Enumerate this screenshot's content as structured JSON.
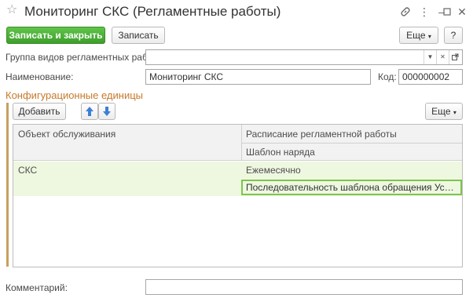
{
  "window": {
    "title": "Мониторинг СКС (Регламентные работы)",
    "icons": [
      "star-icon",
      "link-icon",
      "more-vertical-icon",
      "minimize-icon",
      "maximize-icon",
      "close-icon"
    ]
  },
  "toolbar": {
    "save_close_label": "Записать и закрыть",
    "save_label": "Записать",
    "more_label": "Еще",
    "help_label": "?"
  },
  "form": {
    "group_label": "Группа видов регламентных работ:",
    "group_value": "",
    "name_label": "Наименование:",
    "name_value": "Мониторинг СКС",
    "code_label": "Код:",
    "code_value": "000000002",
    "comment_label": "Комментарий:",
    "comment_value": ""
  },
  "config_units": {
    "section_title": "Конфигурационные единицы",
    "add_label": "Добавить",
    "more_label": "Еще",
    "columns": {
      "object": "Объект обслуживания",
      "schedule": "Расписание регламентной работы",
      "template": "Шаблон наряда"
    },
    "rows": [
      {
        "object": "СКС",
        "schedule": "Ежемесячно",
        "template": "Последовательность шаблона обращения Установ..."
      }
    ]
  },
  "colors": {
    "primary": "#3e9e2c",
    "section_title": "#c7792a",
    "selected_row": "#eef8e0",
    "focus_border": "#7ec44f"
  }
}
